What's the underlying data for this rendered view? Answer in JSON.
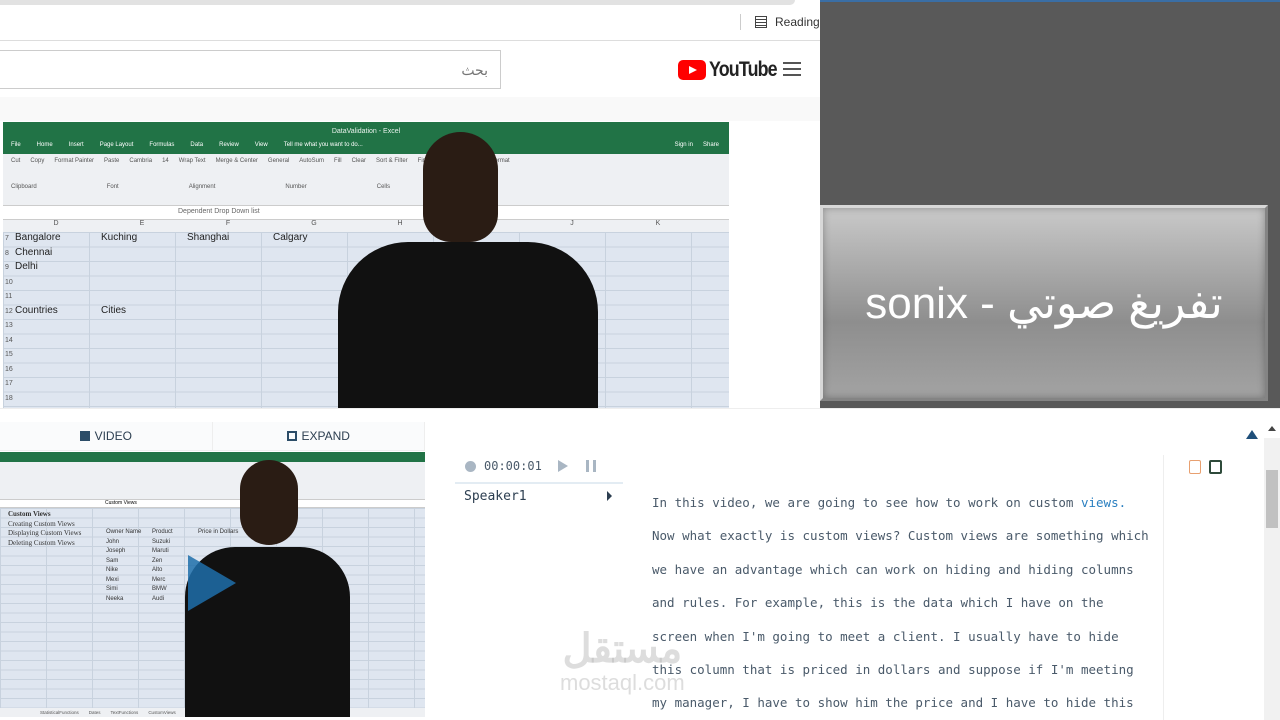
{
  "browser": {
    "reading_list": "Reading li"
  },
  "youtube": {
    "search_placeholder": "بحث",
    "logo_text": "YouTube"
  },
  "video1": {
    "window_title": "DataValidation - Excel",
    "tabs": [
      "File",
      "Home",
      "Insert",
      "Page Layout",
      "Formulas",
      "Data",
      "Review",
      "View",
      "Tell me what you want to do..."
    ],
    "ribbon_groups": [
      "Clipboard",
      "Font",
      "Alignment",
      "Number",
      "Cells",
      "Editing"
    ],
    "ribbon_items": [
      "Cut",
      "Copy",
      "Format Painter",
      "Paste",
      "Cambria",
      "14",
      "Wrap Text",
      "Merge & Center",
      "General",
      "AutoSum",
      "Fill",
      "Clear",
      "Sort & Filter",
      "Find & Select",
      "Delete",
      "Format"
    ],
    "sign_in": "Sign in",
    "share": "Share",
    "name_box": "A1",
    "formula": "Dependent Drop Down list",
    "columns": [
      "D",
      "E",
      "F",
      "G",
      "H",
      "I",
      "J",
      "K"
    ],
    "rows": [
      "7",
      "8",
      "9",
      "10",
      "11",
      "12",
      "13",
      "14",
      "15",
      "16",
      "17",
      "18"
    ],
    "cells": {
      "D7": "Bangalore",
      "E7": "Kuching",
      "F7": "Shanghai",
      "G7": "Calgary",
      "D8": "Chennai",
      "D9": "Delhi",
      "D12": "Countries",
      "E12": "Cities"
    }
  },
  "promo": {
    "title": "sonix - تفريغ صوتي"
  },
  "player": {
    "tab_video": "VIDEO",
    "tab_expand": "EXPAND",
    "frame": {
      "formula": "Custom Views",
      "list": [
        "Custom Views",
        "Creating Custom Views",
        "Displaying Custom Views",
        "Deleting Custom Views"
      ],
      "table_headers": [
        "Owner Name",
        "Product",
        "Price in Dollars"
      ],
      "table_rows": [
        [
          "John",
          "Suzuki"
        ],
        [
          "Joseph",
          "Maruti"
        ],
        [
          "Sam",
          "Zen"
        ],
        [
          "Nike",
          "Alto"
        ],
        [
          "Mexi",
          "Merc"
        ],
        [
          "Simi",
          "BMW"
        ],
        [
          "Neeka",
          "Audi"
        ]
      ],
      "sheets": [
        "StatisticalFunctions",
        "Dates",
        "TextFunctions",
        "CustomViews",
        "ViewingWorksheets"
      ]
    }
  },
  "transcript": {
    "time": "00:00:01",
    "speaker": "Speaker1",
    "lines": [
      "In this video, we are going to see how to work on custom ",
      "Now what exactly is custom views? Custom views are something which",
      "we have an advantage which can work on hiding and hiding columns",
      "and rules. For example, this is the data which I have on the",
      "screen when I'm going to meet a client. I usually have to hide",
      "this column that is priced in dollars and suppose if I'm meeting",
      "my manager, I have to show him the price and I have to hide this"
    ],
    "highlight_word": "views."
  },
  "watermark": {
    "arabic": "مستقل",
    "latin": "mostaql.com"
  },
  "colors": {
    "excel_green": "#217346",
    "promo_bg": "#595959",
    "accent_blue": "#2a7fc0",
    "youtube_red": "#ff0000"
  }
}
